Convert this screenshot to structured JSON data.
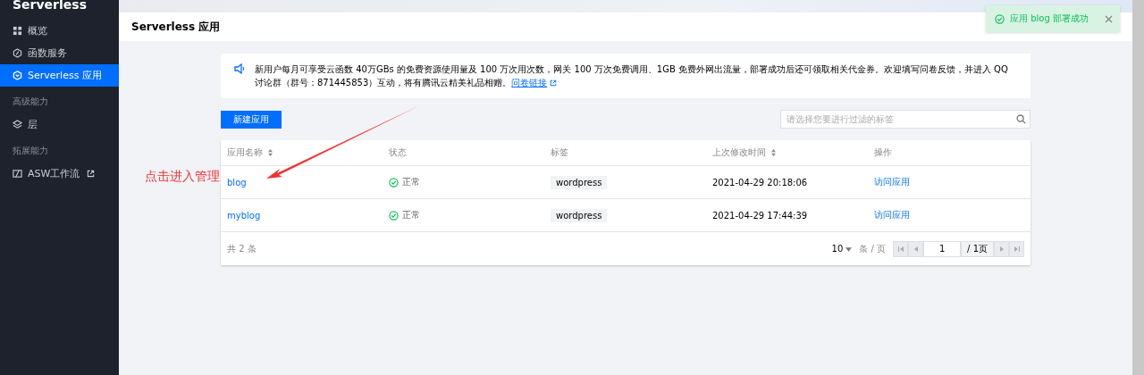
{
  "sidebar": {
    "title": "Serverless",
    "groups": [
      {
        "items": [
          {
            "label": "概览",
            "selected": false,
            "external": false
          },
          {
            "label": "函数服务",
            "selected": false,
            "external": false
          },
          {
            "label": "Serverless 应用",
            "selected": true,
            "external": false
          }
        ]
      },
      {
        "label": "高级能力",
        "items": [
          {
            "label": "层",
            "selected": false,
            "external": false
          }
        ]
      },
      {
        "label": "拓展能力",
        "items": [
          {
            "label": "ASW工作流",
            "selected": false,
            "external": true
          }
        ]
      }
    ]
  },
  "page_title": "Serverless 应用",
  "notice": {
    "text": "新用户每月可享受云函数 40万GBs 的免费资源使用量及 100 万次用次数，网关 100 万次免费调用、1GB 免费外网出流量，部署成功后还可领取相关代金券。欢迎填写问卷反馈，并进入 QQ 讨论群（群号：871445853）互动，将有腾讯云精美礼品相赠。",
    "link": "问卷链接"
  },
  "create_button": "新建应用",
  "search": {
    "placeholder": "请选择您要进行过滤的标签"
  },
  "table": {
    "columns": [
      {
        "label": "应用名称",
        "sortable": true
      },
      {
        "label": "状态",
        "sortable": false
      },
      {
        "label": "标签",
        "sortable": false
      },
      {
        "label": "上次修改时间",
        "sortable": true
      },
      {
        "label": "操作",
        "sortable": false
      }
    ],
    "rows": [
      {
        "name": "blog",
        "status": "正常",
        "tag": "wordpress",
        "modified": "2021-04-29 20:18:06",
        "action": "访问应用"
      },
      {
        "name": "myblog",
        "status": "正常",
        "tag": "wordpress",
        "modified": "2021-04-29 17:44:39",
        "action": "访问应用"
      }
    ],
    "total": "共 2 条",
    "page_size": "10",
    "page_size_unit": "条 / 页",
    "page": "1",
    "page_count": "/ 1页"
  },
  "toast": {
    "text": "应用 blog 部署成功"
  },
  "annotation": "点击进入管理"
}
